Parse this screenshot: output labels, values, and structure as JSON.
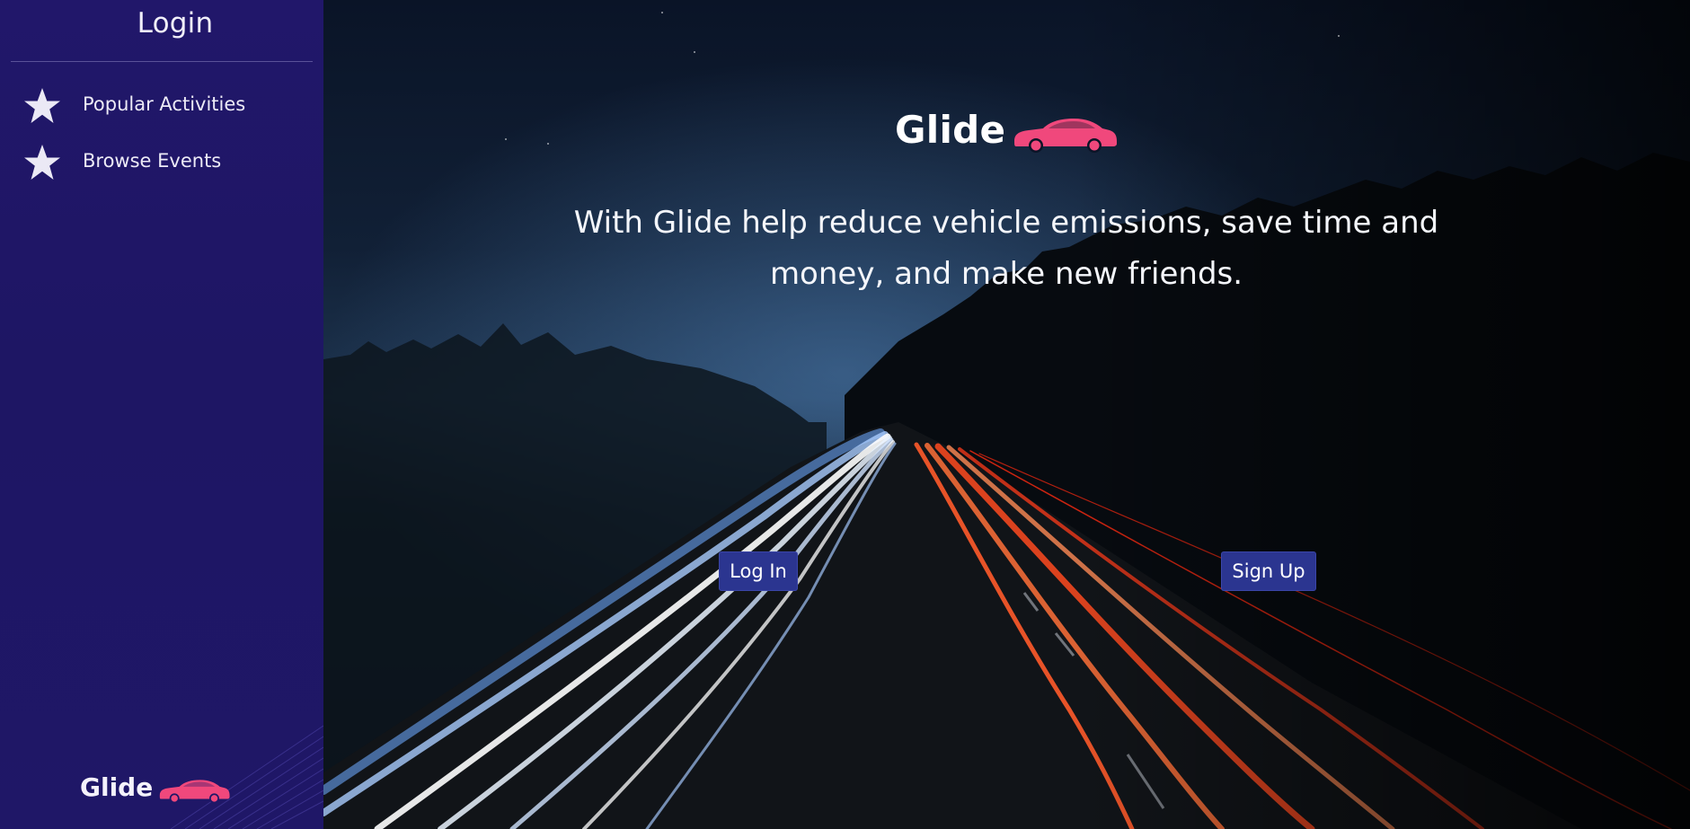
{
  "sidebar": {
    "title": "Login",
    "items": [
      {
        "label": "Popular Activities",
        "icon": "star-icon"
      },
      {
        "label": "Browse Events",
        "icon": "star-icon"
      }
    ],
    "brand": {
      "name": "Glide",
      "icon": "car-icon"
    }
  },
  "hero": {
    "brand": {
      "name": "Glide",
      "icon": "car-icon"
    },
    "tagline": "With Glide help reduce vehicle emissions, save time and money, and make new friends.",
    "login_label": "Log In",
    "signup_label": "Sign Up"
  },
  "colors": {
    "sidebar_bg": "#1f1767",
    "brand_accent": "#f0487c",
    "button_bg": "#2b3590",
    "text_light": "#ffffff"
  }
}
